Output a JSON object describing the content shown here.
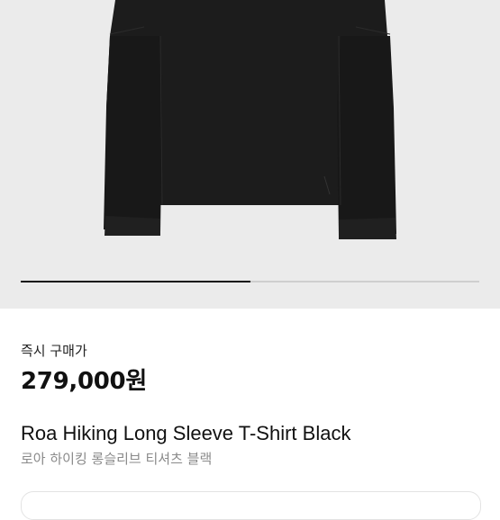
{
  "product": {
    "image_alt": "black long sleeve t-shirt",
    "gallery_progress": 0.5,
    "price_label": "즉시 구매가",
    "price": "279,000원",
    "title_en": "Roa Hiking Long Sleeve T-Shirt Black",
    "title_ko": "로아 하이킹 롱슬리브 티셔츠 블랙"
  },
  "colors": {
    "image_bg": "#ebebeb",
    "shirt": "#1c1c1c",
    "progress_active": "#111111",
    "progress_track": "#cfcfcf",
    "subtitle": "#8a8a8a"
  }
}
